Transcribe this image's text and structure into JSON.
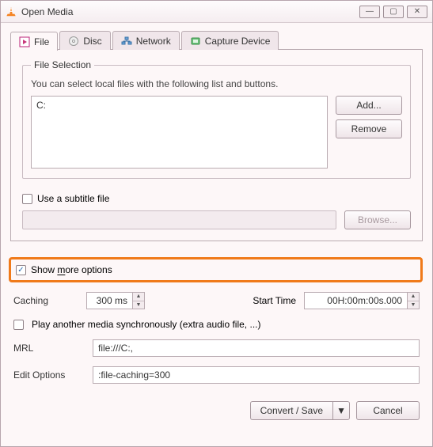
{
  "window": {
    "title": "Open Media"
  },
  "tabs": {
    "file": "File",
    "disc": "Disc",
    "network": "Network",
    "capture": "Capture Device"
  },
  "file_selection": {
    "legend": "File Selection",
    "description": "You can select local files with the following list and buttons.",
    "item0": "C:",
    "add": "Add...",
    "remove": "Remove"
  },
  "subtitle": {
    "label": "Use a subtitle file",
    "browse": "Browse..."
  },
  "show_more_pre": "Show ",
  "show_more_mid": "m",
  "show_more_post": "ore options",
  "options": {
    "caching_label": "Caching",
    "caching_value": "300 ms",
    "start_label": "Start Time",
    "start_value": "00H:00m:00s.000",
    "play_sync": "Play another media synchronously (extra audio file, ...)",
    "mrl_label": "MRL",
    "mrl_value": "file:///C:,",
    "edit_label": "Edit Options",
    "edit_value": ":file-caching=300"
  },
  "footer": {
    "convert": "Convert / Save",
    "cancel": "Cancel"
  }
}
